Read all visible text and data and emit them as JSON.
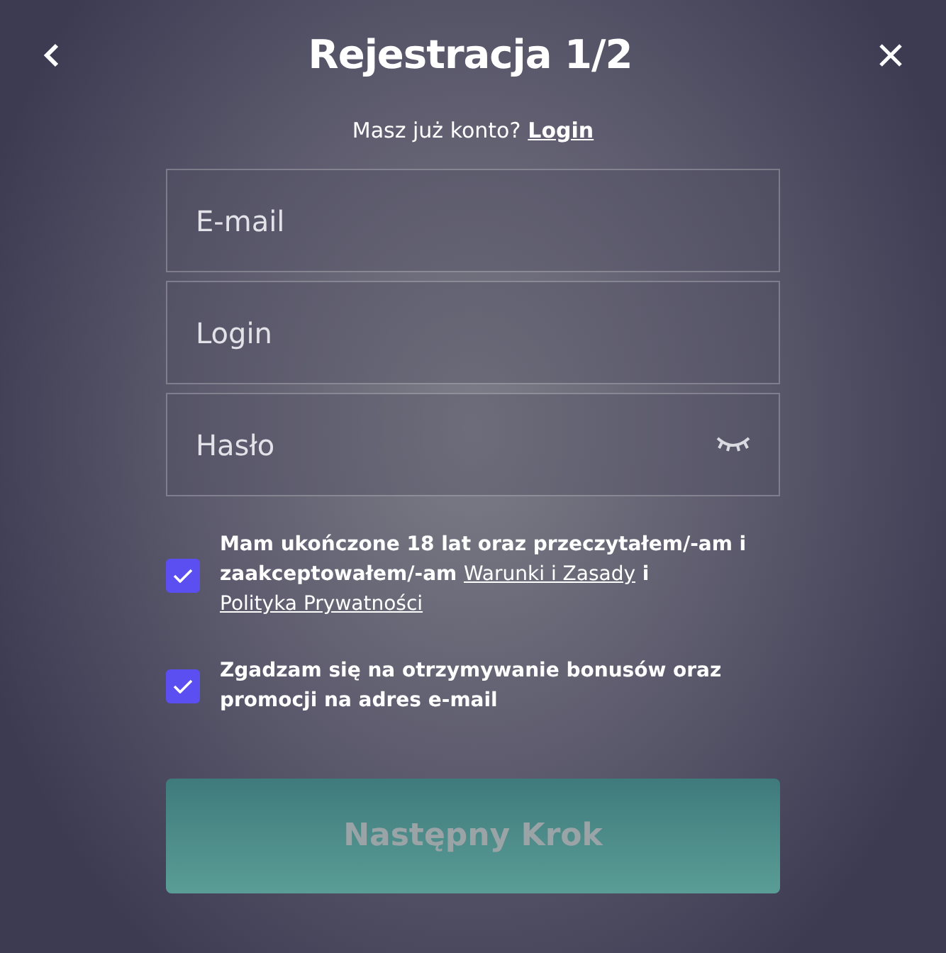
{
  "header": {
    "title": "Rejestracja 1/2"
  },
  "login_prompt": {
    "text": "Masz już konto?",
    "link": "Login"
  },
  "fields": [
    {
      "placeholder": "E-mail",
      "kind": "text"
    },
    {
      "placeholder": "Login",
      "kind": "text"
    },
    {
      "placeholder": "Hasło",
      "kind": "password"
    }
  ],
  "consents": [
    {
      "checked": true,
      "parts": [
        {
          "kind": "text",
          "text": "Mam ukończone 18 lat oraz przeczytałem/-am i zaakceptowałem/-am "
        },
        {
          "kind": "link",
          "text": "Warunki i Zasady"
        },
        {
          "kind": "text",
          "text": " i "
        },
        {
          "kind": "link",
          "text": "Polityka Prywatności"
        }
      ]
    },
    {
      "checked": true,
      "parts": [
        {
          "kind": "text",
          "text": "Zgadzam się na otrzymywanie bonusów oraz promocji na adres e-mail"
        }
      ]
    }
  ],
  "submit": {
    "label": "Następny Krok",
    "disabled": true
  }
}
